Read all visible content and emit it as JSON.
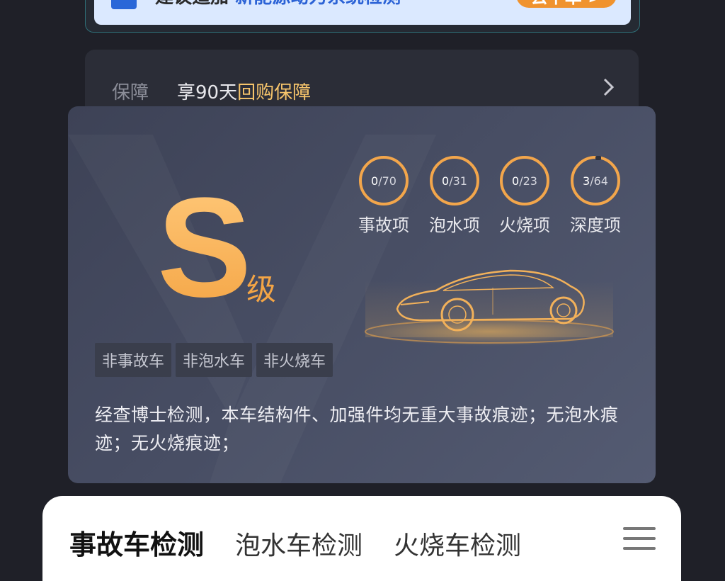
{
  "banner": {
    "text_black": "建议追加",
    "text_blue": "新能源动力系统检测",
    "button_label": "去下单 >"
  },
  "guarantee": {
    "label": "保障",
    "text_prefix": "享90天",
    "text_highlight": "回购保障"
  },
  "grade": {
    "letter": "S",
    "suffix": "级"
  },
  "checks": [
    {
      "done": "0",
      "total": "70",
      "label": "事故项",
      "progress": 0
    },
    {
      "done": "0",
      "total": "31",
      "label": "泡水项",
      "progress": 0
    },
    {
      "done": "0",
      "total": "23",
      "label": "火烧项",
      "progress": 0
    },
    {
      "done": "3",
      "total": "64",
      "label": "深度项",
      "progress": 0.047
    }
  ],
  "tags": [
    "非事故车",
    "非泡水车",
    "非火烧车"
  ],
  "description": "经查博士检测，本车结构件、加强件均无重大事故痕迹；无泡水痕迹；无火烧痕迹；",
  "bottom_tabs": [
    "事故车检测",
    "泡水车检测",
    "火烧车检测"
  ],
  "colors": {
    "accent_orange": "#f3a64b",
    "card_bg": "#474d63",
    "page_bg": "#1f2028",
    "highlight": "#f6c46b"
  }
}
